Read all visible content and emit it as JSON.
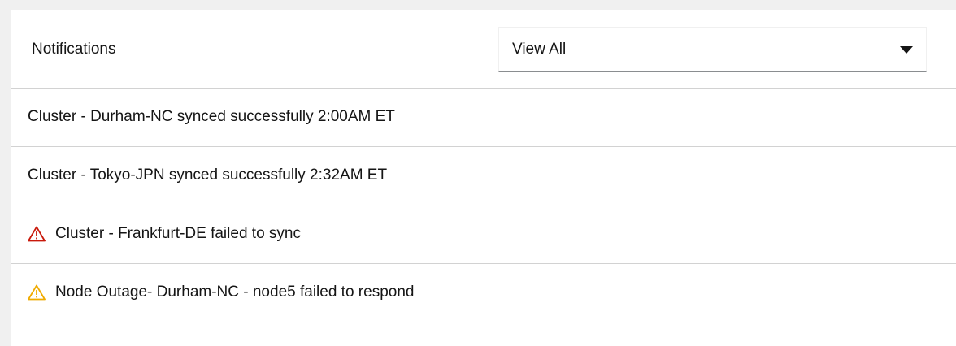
{
  "header": {
    "title": "Notifications",
    "filter": {
      "selected": "View All"
    }
  },
  "notifications": [
    {
      "text": "Cluster - Durham-NC synced successfully 2:00AM ET",
      "icon": ""
    },
    {
      "text": "Cluster - Tokyo-JPN synced successfully 2:32AM ET",
      "icon": ""
    },
    {
      "text": "Cluster  - Frankfurt-DE failed to sync",
      "icon": "danger-triangle-icon"
    },
    {
      "text": "Node Outage- Durham-NC - node5 failed to respond",
      "icon": "warning-triangle-icon"
    }
  ],
  "colors": {
    "danger": "#c9190b",
    "warning": "#f0ab00",
    "border": "#d2d2d2",
    "background": "#f0f0f0"
  }
}
